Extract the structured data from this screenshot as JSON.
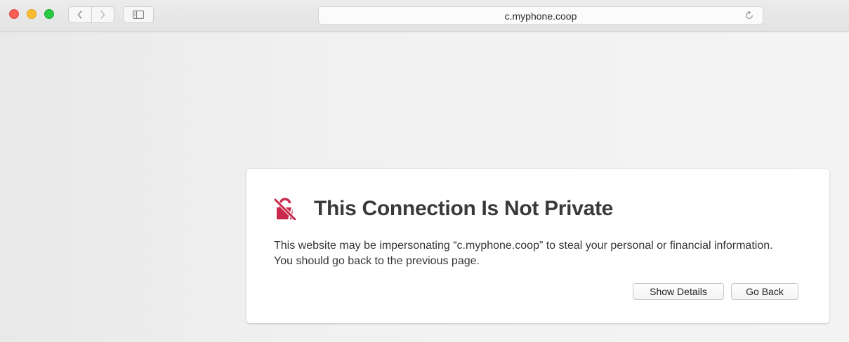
{
  "browser": {
    "address": "c.myphone.coop",
    "colors": {
      "close": "#fc5f57",
      "minimize": "#fdbc2e",
      "maximize": "#28c840"
    },
    "icons": {
      "back": "chevron-left-icon",
      "forward": "chevron-right-icon",
      "sidebar": "sidebar-icon",
      "reload": "reload-icon"
    }
  },
  "warning": {
    "title": "This Connection Is Not Private",
    "message": "This website may be impersonating “c.myphone.coop” to steal your personal or financial information. You should go back to the previous page.",
    "icon": "broken-lock-icon",
    "icon_color": "#c8294a",
    "buttons": {
      "show_details": "Show Details",
      "go_back": "Go Back"
    }
  }
}
